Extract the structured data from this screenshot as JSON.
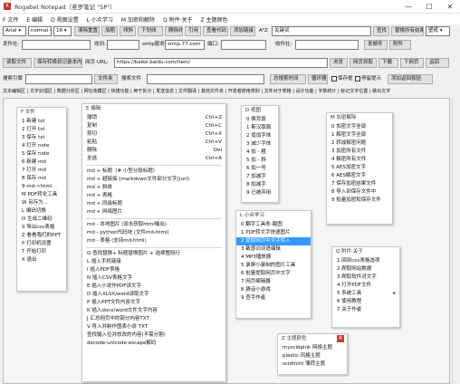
{
  "window": {
    "title": "Rogabet Notepad（老罗笔记 \"SP\"）",
    "minimize": "—",
    "maximize": "☐",
    "close": "✕"
  },
  "menu": [
    "F 文件",
    "E 编辑",
    "D 视图设置",
    "L 小众学习",
    "M 加密和解除",
    "Q 附件·关于",
    "Z 主题颜色"
  ],
  "toolbar1": {
    "font": "Arial",
    "size": "normal",
    "size_num": "16",
    "clear_btn": "清除重置",
    "b1": "加粗",
    "b2": "倾斜",
    "b3": "下划线",
    "b4": "删除线",
    "b5": "引用",
    "b6": "查看代码",
    "b7": "添加链接",
    "b8": "A²Z",
    "find_value": "关键词",
    "find_btn": "查找",
    "replace_btn": "替换所有结果",
    "theme_label": "壁纸"
  },
  "toolbar2": {
    "sender_label": "发件社:",
    "receiver_label": "收到:",
    "smtp_label": "smtp服务",
    "smtp_value": "smtp.77.com",
    "port_label": "端口:",
    "port_value": "",
    "recv_label": "收件社:",
    "send_btn": "发邮件",
    "attach_btn": "附件"
  },
  "toolbar3": {
    "b1": "读取文件",
    "b2": "保存转换到记录本内容",
    "url_label": "网页-URL:",
    "url_value": "https://baike.baidu.com/item/",
    "b3": "浏览",
    "b4": "网页抓取",
    "b5": "下载",
    "b6": "下网页",
    "b7": "返回"
  },
  "toolbar4": {
    "label1": "搜索引擎",
    "value1": "",
    "b1": "文件夹",
    "label2": "搜索文件",
    "label3": "总搜索时间",
    "b2": "循环器",
    "chk1": "保存框",
    "chk2": "停留提示",
    "b3": "添加返回按钮"
  },
  "tabs": "文本编辑区 | 文字处理区 | 数据分析区 | 网址收藏区 | 快捷功能 | 用于拆分 | 发送信息 | 文件翻译 | 其他文件夹 | 开发者使用类别 | 文件对于表格 | 设计功能 | 字数统计 | 标记文字位置 | 跳出文字",
  "panel_file": {
    "title": "F 文件",
    "items": [
      "1 新建 txt",
      "2 打开 txt",
      "3 保存 txt",
      "4 打开 note",
      "5 保存 note",
      "6 新建 md",
      "7 打开 md",
      "8 保存 md",
      "9 md->html",
      "M PDF转化工具",
      "W 另存为...",
      "L 编码切换",
      "O 生成二维码",
      "S 导出csv表格",
      "Z 看看我们的PPT",
      "P 打印机设置",
      "T 开始打印",
      "X 退出"
    ]
  },
  "panel_edit": {
    "title": "E 编辑",
    "items": [
      {
        "t": "撤销",
        "sc": "Ctrl+Z"
      },
      {
        "t": "复制",
        "sc": "Ctrl+C"
      },
      {
        "t": "剪切",
        "sc": "Ctrl+X"
      },
      {
        "t": "粘贴",
        "sc": "Ctrl+V"
      },
      {
        "t": "删除",
        "sc": "Del"
      },
      {
        "t": "全选",
        "sc": "Ctrl+A"
      }
    ],
    "items2": [
      "md + 标题（# 小型分段标题）",
      "md + 超链接 [markdown文件部分文字](url)",
      "md + 斜体",
      "md + 表格",
      "md + 同级标题",
      "md + 网络图片"
    ],
    "items3": [
      "md - 本地图片 (双击获取html输出)",
      "md - python代码块 (文件md-html)",
      "md - 表格 (支持md-html)"
    ],
    "items4": [
      "Q 查找替换+ 标题替换图片 + 选择整段行",
      "L 插入手机链接",
      "I 插入PDF表格",
      "N 插入CSV表格文字",
      "E 插入小说作PDF读文字",
      "D 插入XLSX/word读取文字",
      "P 插入PPT文件内容文字",
      "K 插入docx/word文件文字内容",
      "J 汇总网页中的部分内容TXT",
      "V 导入并制作图表小说 TXT",
      "查找输入位并修改的内容(不需分割)",
      "decode-unicode-escape解码"
    ]
  },
  "panel_view": {
    "title": "D 视图",
    "items": [
      "0 换背景",
      "1 斯汉版面",
      "2 增加字体",
      "3 减少字体",
      "4 加 - 粗",
      "5 加 - 斜",
      "6 加一号",
      "7 加减字",
      "8 加减字",
      "9 已被弃用"
    ]
  },
  "panel_learn": {
    "title": "L 小众学习",
    "items": [
      "0 翻字工具条-截图",
      "1 PDF转文字快速图片",
      "2 提取网页中文字转入",
      "3 敏感词词语编辑",
      "4 MP3播放器",
      "5 录屏小录制的图片工具",
      "6 批量提取网页中文字",
      "7 网页编辑器",
      "8 猜话小游戏",
      "9 查字作者"
    ],
    "selected": 2
  },
  "panel_crypt": {
    "title": "M 加密解除",
    "items": [
      "0 加密文字全部",
      "1 解密文字全部",
      "2 转成解密问题",
      "3 加密所有文件",
      "4 解密所有文件",
      "5 AES加密文字",
      "6 AES解密文字",
      "7 保存加密结果文件",
      "8 导入到保存文件中",
      "9 批量加密和保存文件"
    ]
  },
  "panel_about": {
    "title": "Q 附件·关于",
    "items": [
      "1 回到csv表格选项",
      "2 爬取网站数据",
      "3 爬取软件对文字",
      "4 打开PDF文件",
      "5 系统工具",
      "6 使用教程",
      "7 关于作者"
    ],
    "arrow_index": 4
  },
  "panel_theme": {
    "title": "Z 主题颜色",
    "items": [
      "myscidpink 网络主题",
      "plastic 风格主题",
      "scidmint 薄荷主题"
    ]
  }
}
